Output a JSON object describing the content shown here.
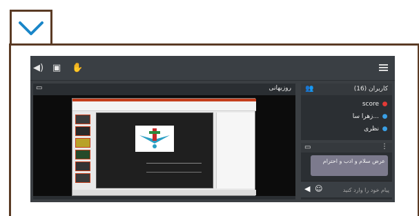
{
  "colors": {
    "frame_border": "#5a3a24",
    "chevron": "#1a86c8",
    "app_bg": "#3b3f43",
    "panel_bg": "#2b2f33",
    "user_icon_red": "#e33a36",
    "user_icon_blue": "#3aa0e6",
    "message_bubble": "#7c7a8d",
    "ppt_accent": "#c43e1c"
  },
  "icons": {
    "collapse": "chevron-down-icon",
    "audio": "speaker-icon",
    "video": "video-icon",
    "raise_hand": "hand-icon",
    "menu": "hamburger-icon",
    "presentation": "screen-icon",
    "users": "users-icon",
    "chat": "chat-icon",
    "options": "vertical-dots-icon",
    "send": "send-icon",
    "emoji": "emoji-icon"
  },
  "presentation": {
    "title": "روزبهانی"
  },
  "users": {
    "title": "کاربران (16)",
    "list": [
      {
        "name": "score",
        "color": "#e33a36"
      },
      {
        "name": "زهرا سا...",
        "color": "#3aa0e6"
      },
      {
        "name": "نظری",
        "color": "#3aa0e6"
      }
    ]
  },
  "chat": {
    "message": "عرض سلام و ادب و احترام",
    "input_placeholder": "پیام خود را وارد کنید"
  }
}
